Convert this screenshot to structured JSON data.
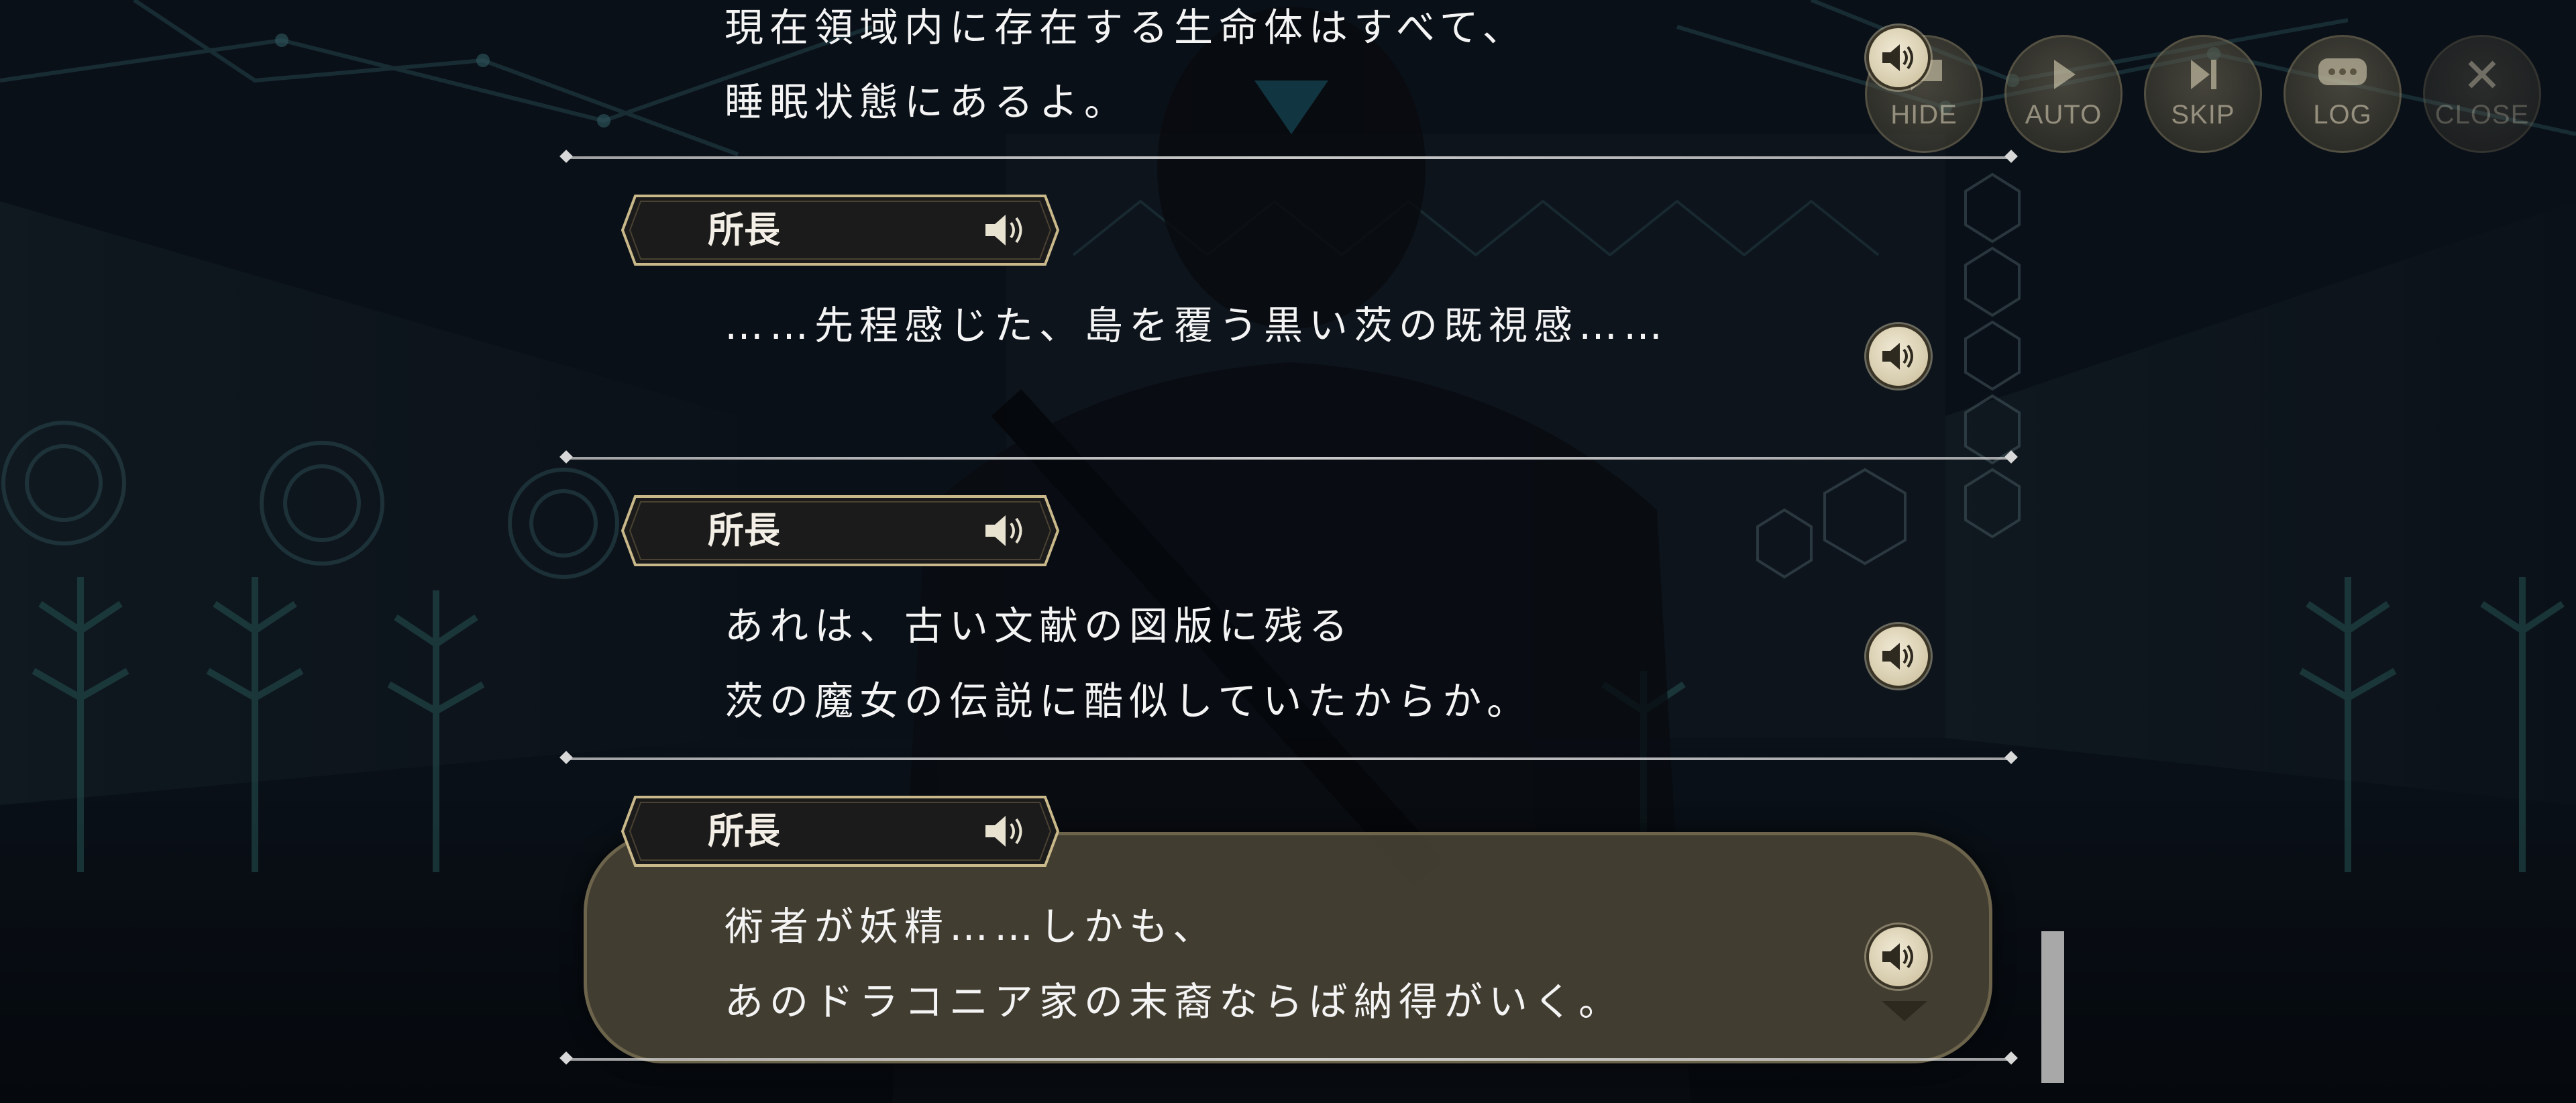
{
  "controls": [
    {
      "key": "hide",
      "label": "HIDE",
      "icon": "speech-bubble-icon"
    },
    {
      "key": "auto",
      "label": "AUTO",
      "icon": "play-icon"
    },
    {
      "key": "skip",
      "label": "SKIP",
      "icon": "skip-icon"
    },
    {
      "key": "log",
      "label": "LOG",
      "icon": "chat-bubble-icon"
    },
    {
      "key": "close",
      "label": "CLOSE",
      "icon": "close-icon"
    }
  ],
  "log": {
    "entries": [
      {
        "speaker": "",
        "lines": [
          "現在領域内に存在する生命体はすべて、",
          "睡眠状態にあるよ。"
        ]
      },
      {
        "speaker": "所長",
        "lines": [
          "……先程感じた、島を覆う黒い茨の既視感……"
        ]
      },
      {
        "speaker": "所長",
        "lines": [
          "あれは、古い文献の図版に残る",
          "茨の魔女の伝説に酷似していたからか。"
        ]
      },
      {
        "speaker": "所長",
        "lines": [
          "術者が妖精……しかも、",
          "あのドラコニア家の末裔ならば納得がいく。"
        ]
      }
    ]
  },
  "colors": {
    "accent_gold": "#c8b88a",
    "plate_dark": "#1b1b1b",
    "text": "#f4f4f4",
    "message_box": "#4a4436"
  }
}
